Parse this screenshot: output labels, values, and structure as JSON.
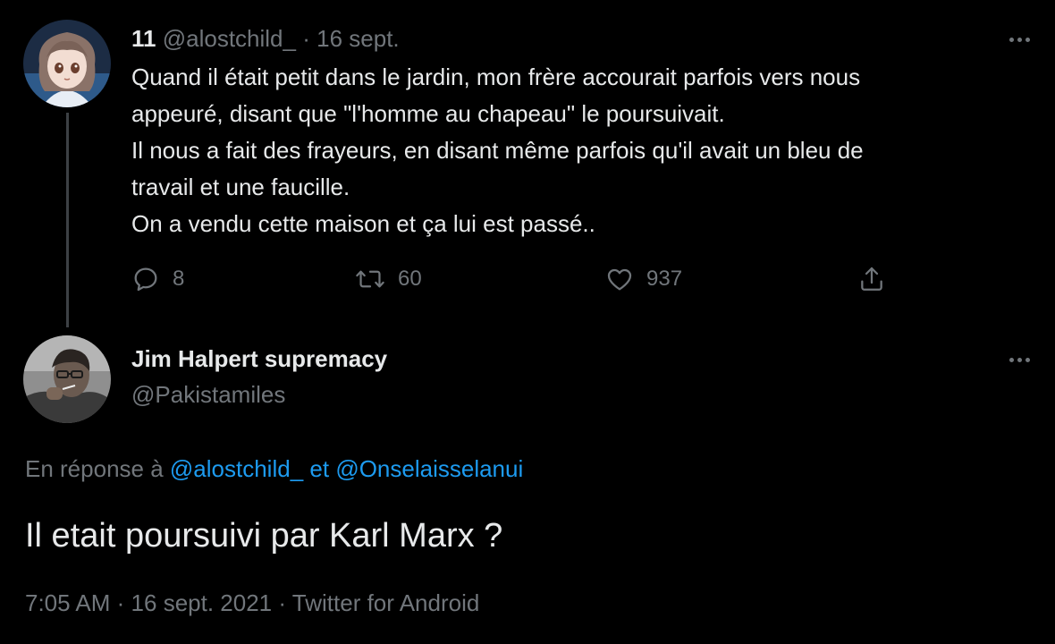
{
  "reply_tweet": {
    "author_name": "11",
    "handle": "@alostchild_",
    "separator": "·",
    "date": "16 sept.",
    "text_lines": [
      "Quand il était petit dans le jardin, mon frère accourait parfois vers nous",
      "appeuré, disant que \"l'homme au chapeau\" le poursuivait.",
      "Il nous a fait des frayeurs, en disant même  parfois qu'il avait un bleu de",
      "travail et une faucille.",
      "On a vendu cette maison et ça lui est passé.."
    ],
    "actions": {
      "reply_count": "8",
      "retweet_count": "60",
      "like_count": "937"
    }
  },
  "main_tweet": {
    "author_name": "Jim Halpert supremacy",
    "handle": "@Pakistamiles",
    "in_reply_prefix": "En réponse à",
    "mention_1": "@alostchild_",
    "conjunction": "et",
    "mention_2": "@Onselaisselanui",
    "text": "Il etait poursuivi par Karl Marx ?",
    "time": "7:05 AM",
    "separator": "·",
    "date": "16 sept. 2021",
    "source": "Twitter for Android"
  },
  "icons": {
    "more": "more-icon",
    "reply": "reply-icon",
    "retweet": "retweet-icon",
    "like": "heart-icon",
    "share": "share-icon"
  },
  "colors": {
    "background": "#000000",
    "text_primary": "#e7e9ea",
    "text_secondary": "#71767b",
    "link": "#1d9bf0",
    "thread_line": "#3d4145"
  }
}
